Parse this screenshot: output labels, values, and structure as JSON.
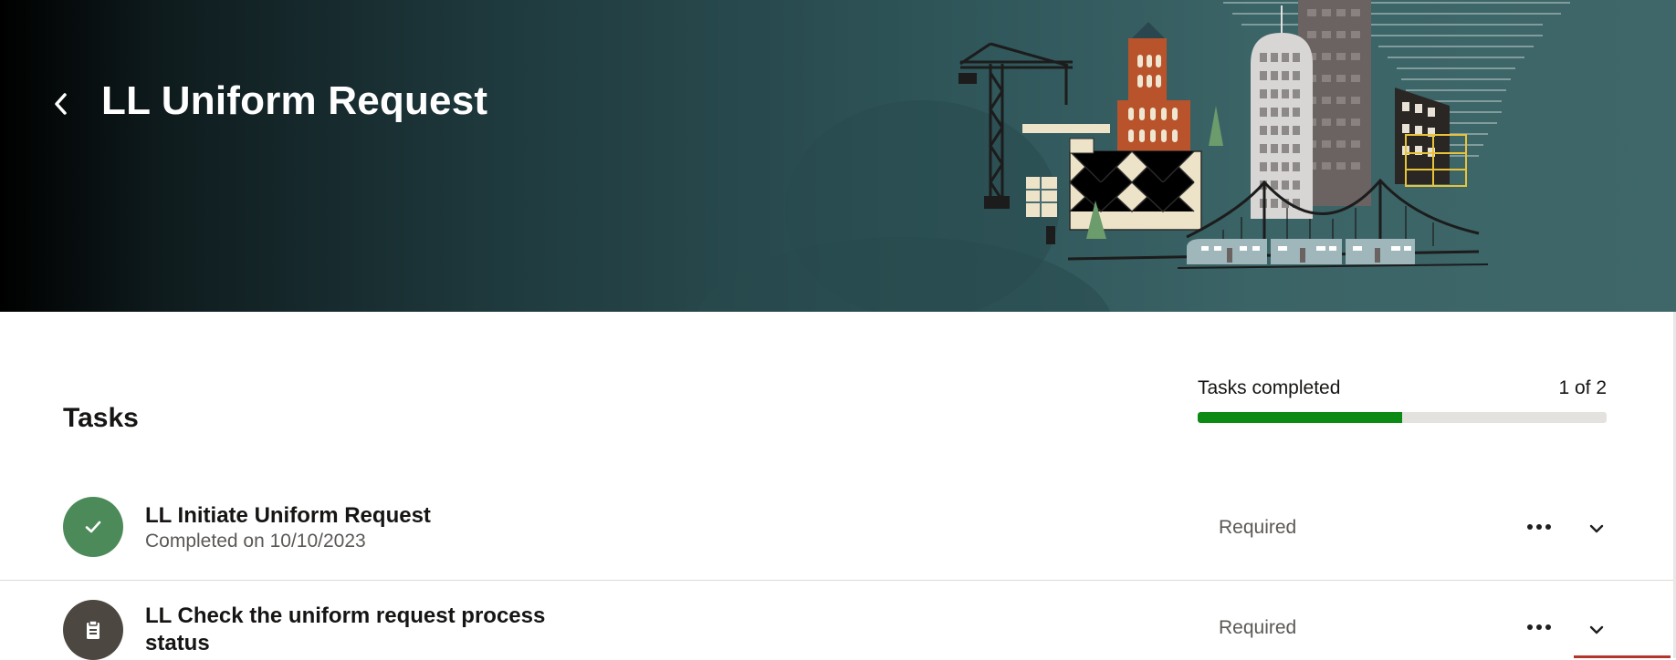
{
  "header": {
    "back_icon": "chevron-left-icon",
    "title": "LL Uniform Request"
  },
  "tasks": {
    "heading": "Tasks",
    "progress": {
      "label": "Tasks completed",
      "count_text": "1 of 2",
      "completed": 1,
      "total": 2,
      "fill_color": "#0c8a14"
    },
    "items": [
      {
        "title": "LL Initiate Uniform Request",
        "subtitle": "Completed on 10/10/2023",
        "status": "Required",
        "icon": "checkmark-icon",
        "icon_color": "#4d8a5a"
      },
      {
        "title": "LL Check the uniform request process status",
        "subtitle": "",
        "status": "Required",
        "icon": "clipboard-icon",
        "icon_color": "#4c4741"
      }
    ]
  }
}
